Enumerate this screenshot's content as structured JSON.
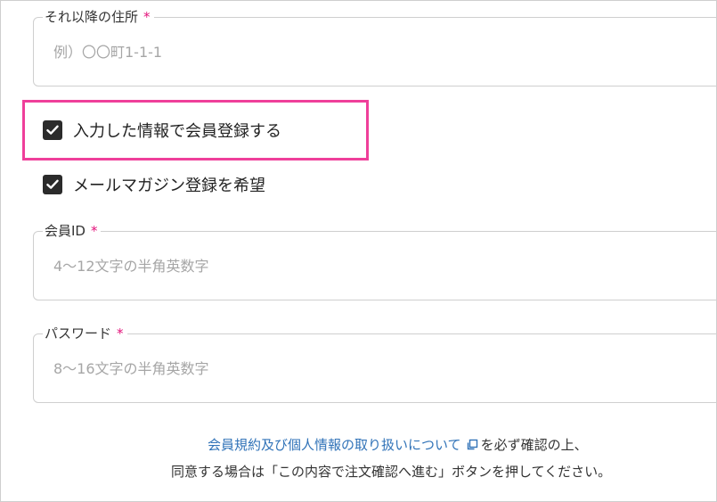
{
  "address_more": {
    "label": "それ以降の住所",
    "required_mark": "*",
    "placeholder": "例）〇〇町1-1-1"
  },
  "register_member": {
    "label": "入力した情報で会員登録する",
    "checked": true
  },
  "newsletter": {
    "label": "メールマガジン登録を希望",
    "checked": true
  },
  "member_id": {
    "label": "会員ID",
    "required_mark": "*",
    "placeholder": "4〜12文字の半角英数字"
  },
  "password": {
    "label": "パスワード",
    "required_mark": "*",
    "placeholder": "8〜16文字の半角英数字"
  },
  "notice": {
    "link_text": "会員規約及び個人情報の取り扱いについて",
    "line1_suffix": "を必ず確認の上、",
    "line2": "同意する場合は「この内容で注文確認へ進む」ボタンを押してください。"
  },
  "colors": {
    "required": "#e3127a",
    "highlight": "#ef3f9a",
    "link": "#3173b8",
    "checkbox": "#2b2b2b"
  }
}
